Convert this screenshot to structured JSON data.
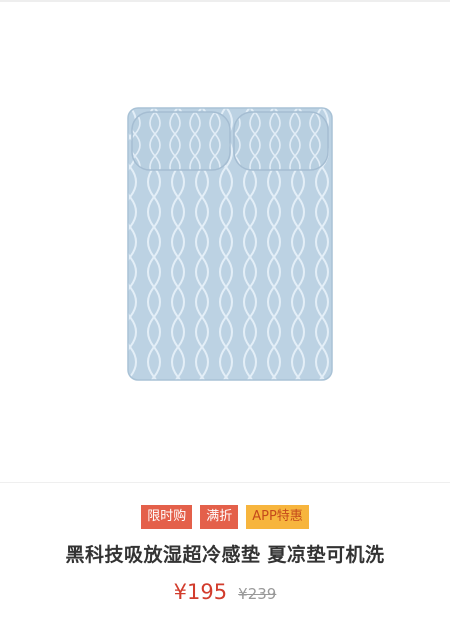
{
  "product": {
    "image_icon": "mattress-pad-image",
    "tags": [
      {
        "label": "限时购",
        "color": "#e4604a"
      },
      {
        "label": "满折",
        "color": "#e4604a"
      },
      {
        "label": "APP特惠",
        "color": "#f7b53d"
      }
    ],
    "title": "黑科技吸放湿超冷感垫 夏凉垫可机洗",
    "price": "¥195",
    "original_price": "¥239"
  }
}
